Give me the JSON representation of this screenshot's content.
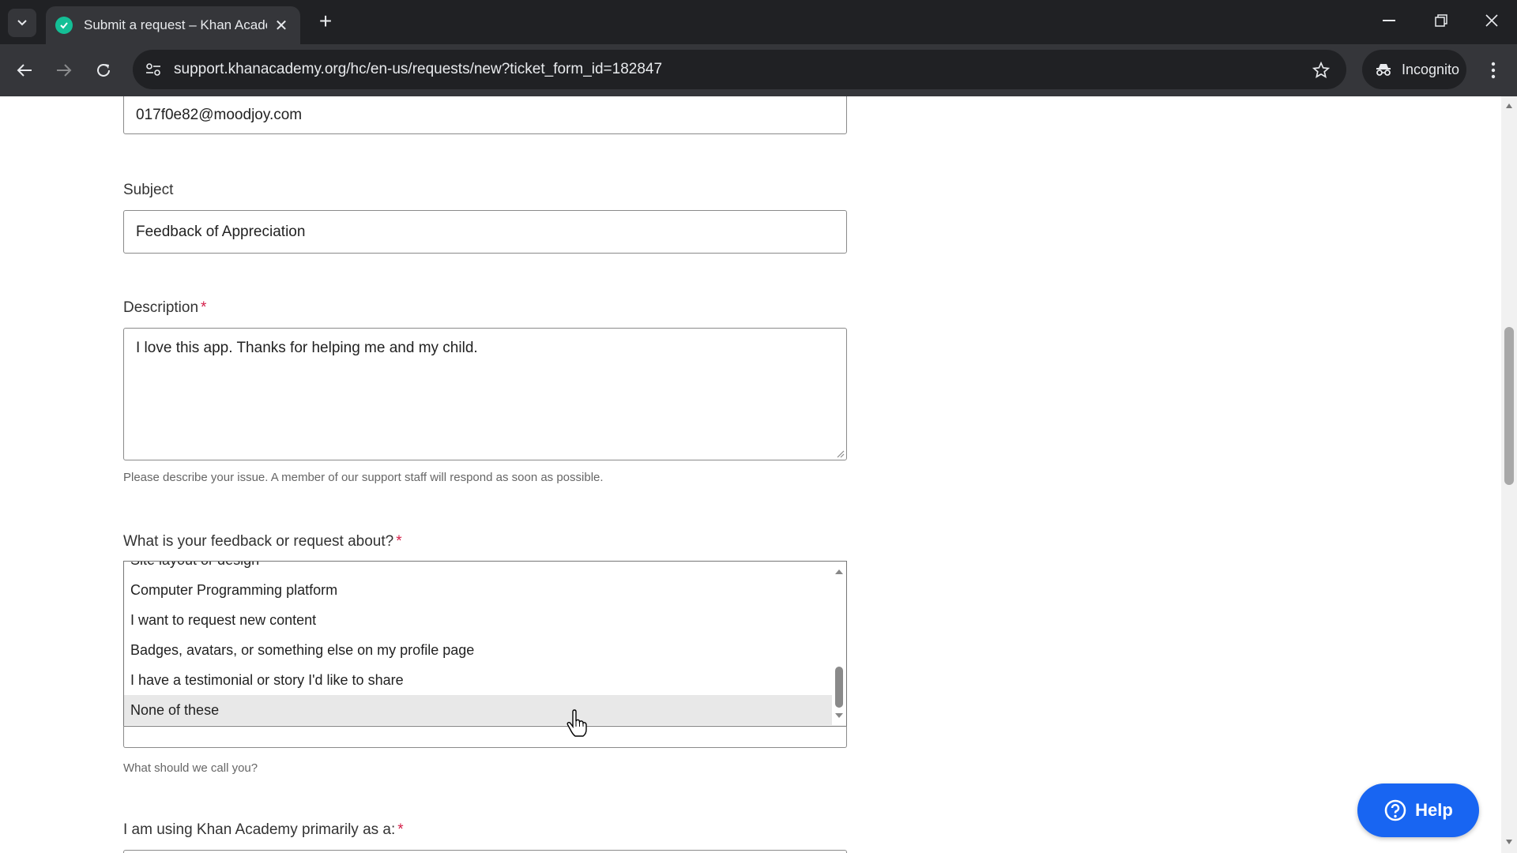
{
  "browser": {
    "tab_title": "Submit a request – Khan Academy",
    "url": "support.khanacademy.org/hc/en-us/requests/new?ticket_form_id=182847",
    "incognito_label": "Incognito"
  },
  "form": {
    "email_value": "017f0e82@moodjoy.com",
    "subject_label": "Subject",
    "subject_value": "Feedback of Appreciation",
    "description_label": "Description",
    "required_mark": "*",
    "description_value": "I love this app. Thanks for helping me and my child.",
    "description_hint": "Please describe your issue. A member of our support staff will respond as soon as possible.",
    "topic_label": "What is your feedback or request about?",
    "topic_options": [
      "Site layout or design",
      "Computer Programming platform",
      "I want to request new content",
      "Badges, avatars, or something else on my profile page",
      "I have a testimonial or story I'd like to share",
      "None of these"
    ],
    "topic_highlighted": "None of these",
    "name_hint": "What should we call you?",
    "usage_label": "I am using Khan Academy primarily as a:"
  },
  "help_button": {
    "label": "Help"
  },
  "colors": {
    "accent": "#1865f2",
    "required": "#d4204a",
    "favicon": "#14bf96"
  }
}
